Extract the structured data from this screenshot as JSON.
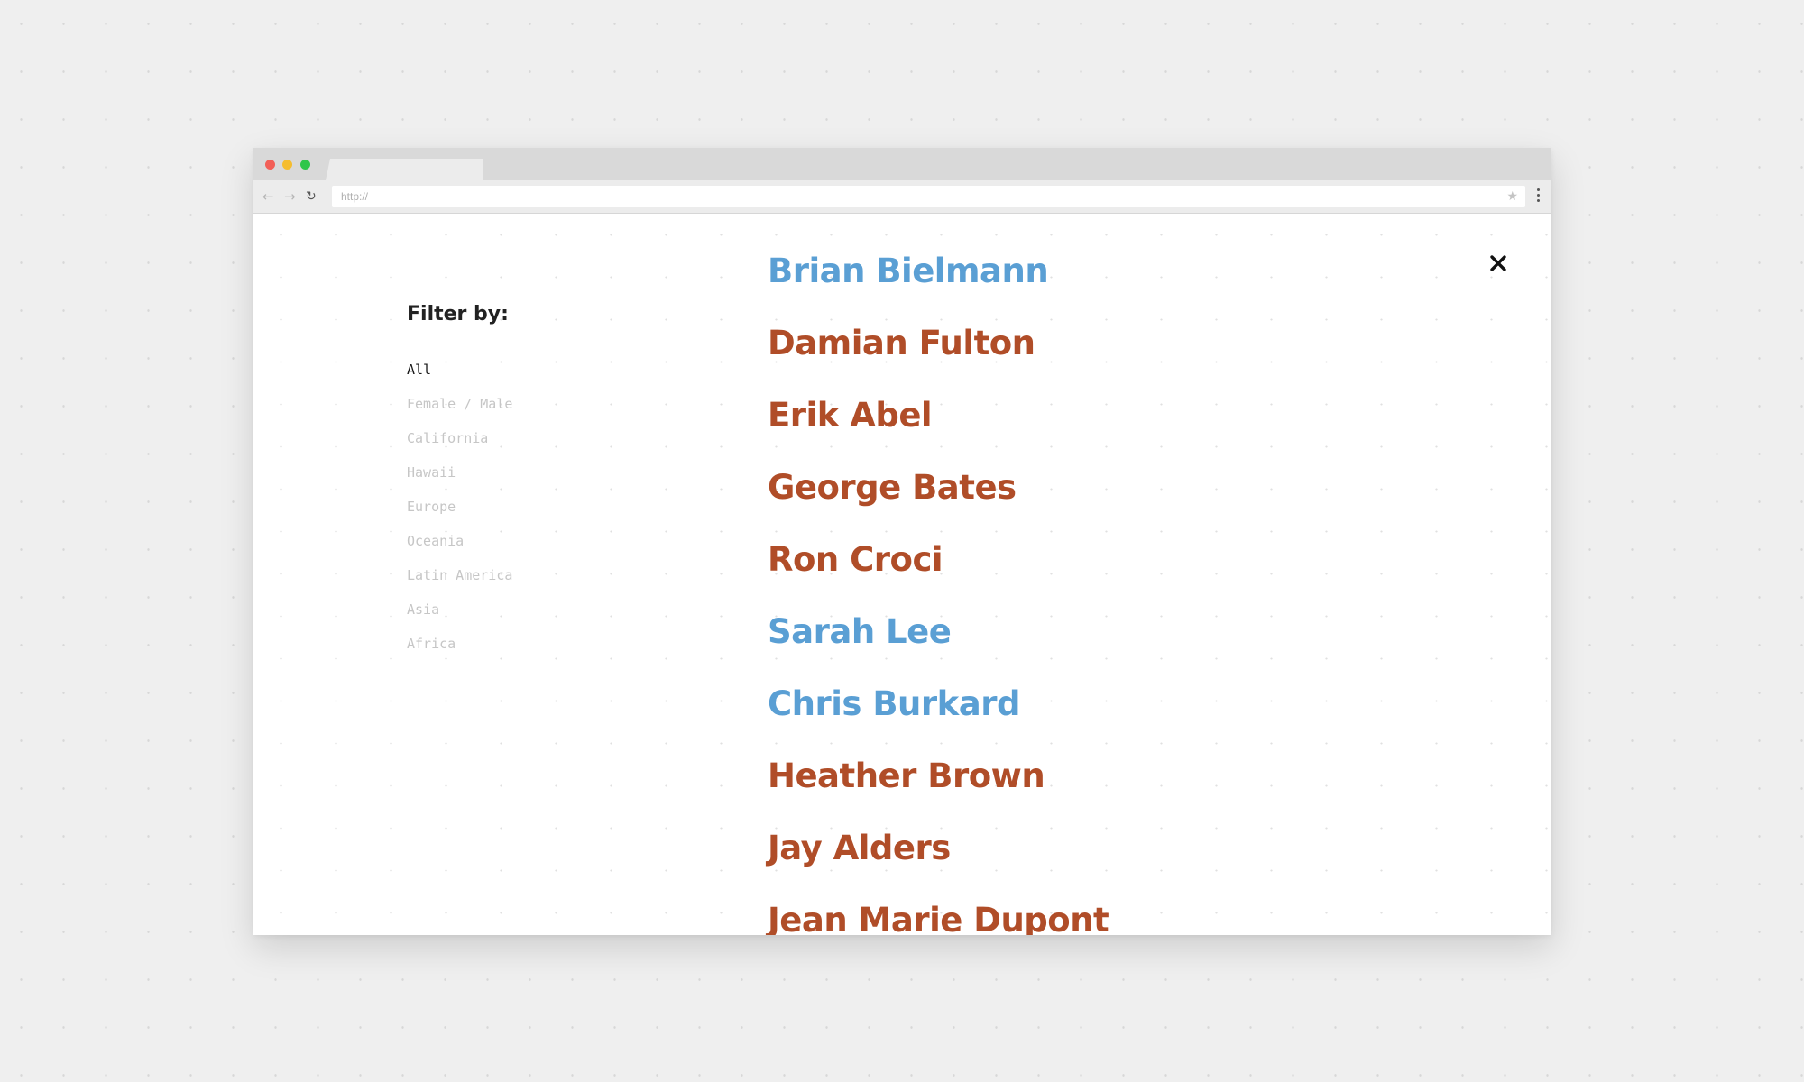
{
  "browser": {
    "url": "http://",
    "colors": {
      "close_dot": "#f25f57",
      "minimize_dot": "#f5bd2f",
      "zoom_dot": "#2fc64a"
    }
  },
  "close_icon": "close-icon",
  "filter": {
    "title": "Filter by:",
    "items": [
      {
        "label": "All",
        "active": true
      },
      {
        "label": "Female / Male",
        "active": false
      },
      {
        "label": "California",
        "active": false
      },
      {
        "label": "Hawaii",
        "active": false
      },
      {
        "label": "Europe",
        "active": false
      },
      {
        "label": "Oceania",
        "active": false
      },
      {
        "label": "Latin America",
        "active": false
      },
      {
        "label": "Asia",
        "active": false
      },
      {
        "label": "Africa",
        "active": false
      }
    ]
  },
  "names": {
    "colors": {
      "blue": "#5a9fd4",
      "rust": "#b04d28"
    },
    "items": [
      {
        "name": "Brian Bielmann",
        "color": "blue"
      },
      {
        "name": "Damian Fulton",
        "color": "rust"
      },
      {
        "name": "Erik Abel",
        "color": "rust"
      },
      {
        "name": "George Bates",
        "color": "rust"
      },
      {
        "name": "Ron Croci",
        "color": "rust"
      },
      {
        "name": "Sarah Lee",
        "color": "blue"
      },
      {
        "name": "Chris Burkard",
        "color": "blue"
      },
      {
        "name": "Heather Brown",
        "color": "rust"
      },
      {
        "name": "Jay Alders",
        "color": "rust"
      },
      {
        "name": "Jean Marie Dupont",
        "color": "rust"
      }
    ]
  }
}
